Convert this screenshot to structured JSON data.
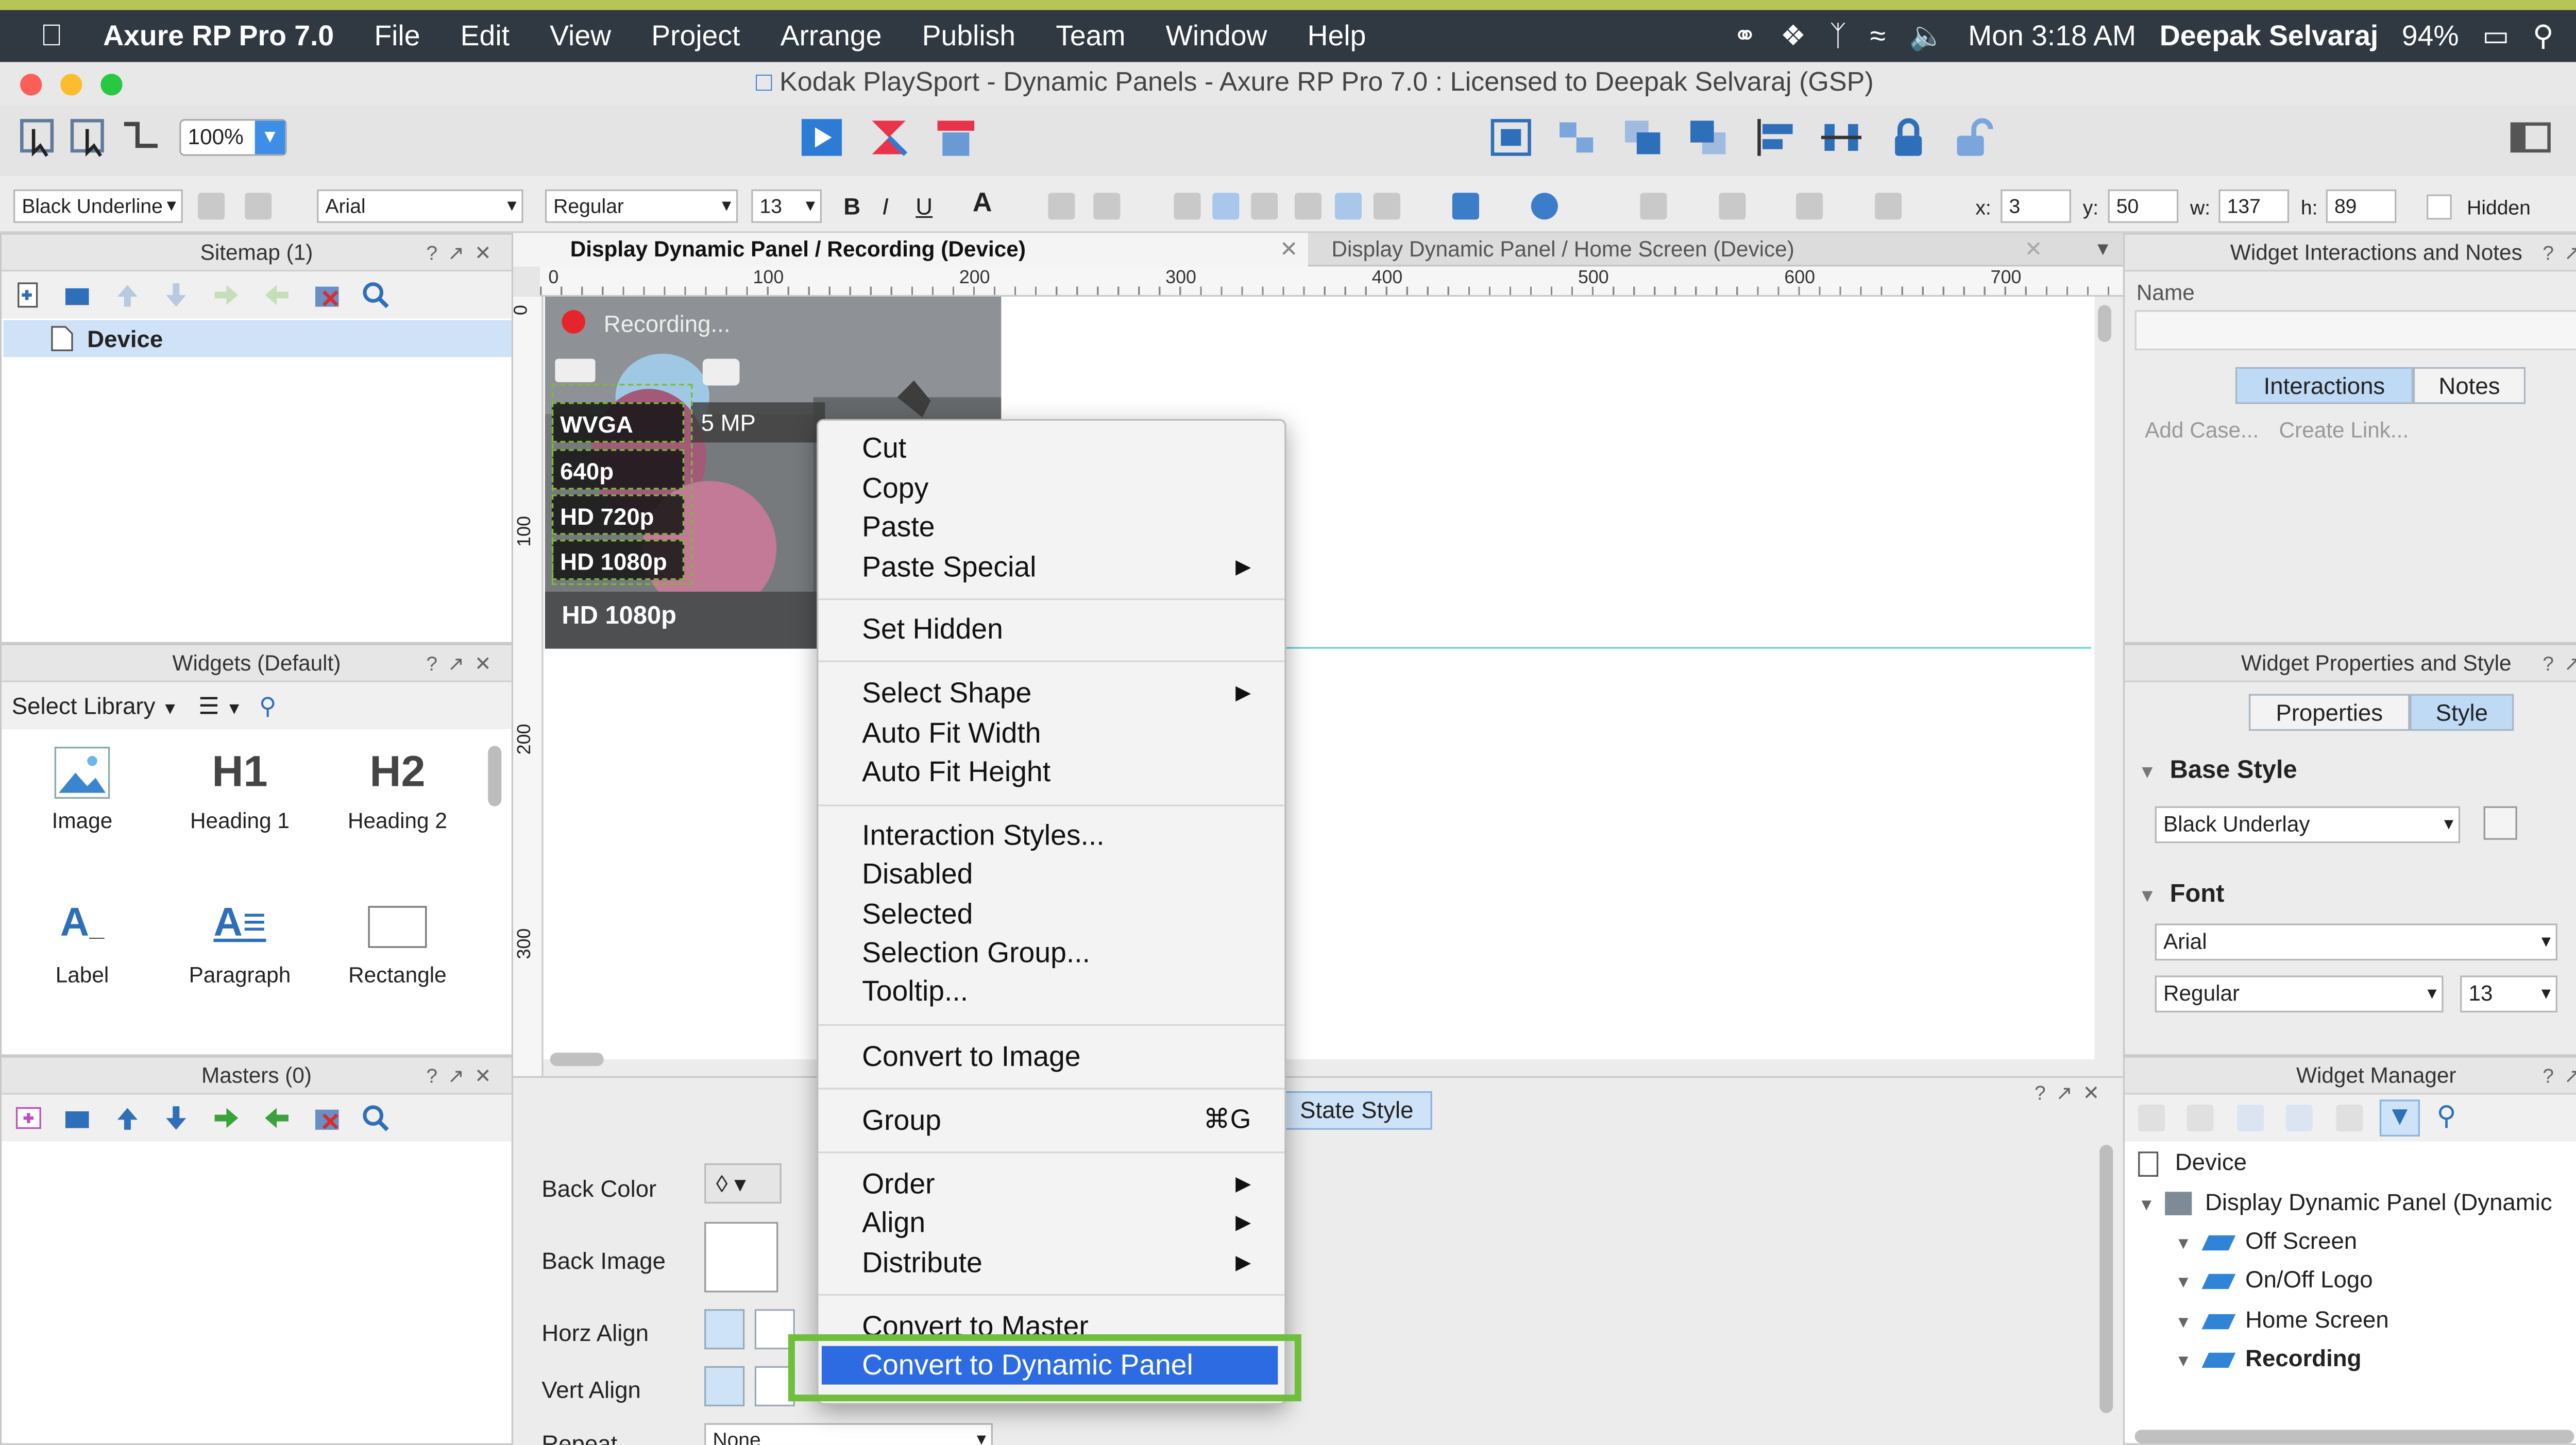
{
  "menubar": {
    "app_name": "Axure RP Pro 7.0",
    "menus": [
      "File",
      "Edit",
      "View",
      "Project",
      "Arrange",
      "Publish",
      "Team",
      "Window",
      "Help"
    ],
    "clock": "Mon 3:18 AM",
    "user": "Deepak Selvaraj",
    "battery": "94%"
  },
  "window": {
    "title": "Kodak PlaySport - Dynamic Panels - Axure RP Pro 7.0 : Licensed to Deepak Selvaraj (GSP)"
  },
  "toolbar": {
    "zoom": "100%"
  },
  "format_bar": {
    "style": "Black Underline",
    "font": "Arial",
    "weight": "Regular",
    "size": "13",
    "x_label": "x:",
    "x": "3",
    "y_label": "y:",
    "y": "50",
    "w_label": "w:",
    "w": "137",
    "h_label": "h:",
    "h": "89",
    "hidden_label": "Hidden"
  },
  "sitemap": {
    "title": "Sitemap (1)",
    "page": "Device"
  },
  "widgets": {
    "title": "Widgets (Default)",
    "select_library": "Select Library",
    "items": [
      {
        "icon": "image-icon",
        "glyph": "",
        "label": "Image"
      },
      {
        "icon": "heading1-icon",
        "glyph": "H1",
        "label": "Heading 1"
      },
      {
        "icon": "heading2-icon",
        "glyph": "H2",
        "label": "Heading 2"
      },
      {
        "icon": "label-icon",
        "glyph": "A_",
        "label": "Label"
      },
      {
        "icon": "paragraph-icon",
        "glyph": "A≡",
        "label": "Paragraph"
      },
      {
        "icon": "rectangle-icon",
        "glyph": "",
        "label": "Rectangle"
      }
    ]
  },
  "masters": {
    "title": "Masters (0)"
  },
  "tabs": [
    {
      "label": "Display Dynamic Panel / Recording (Device)",
      "active": true
    },
    {
      "label": "Display Dynamic Panel / Home Screen (Device)",
      "active": false
    }
  ],
  "ruler": {
    "h_ticks": [
      "0",
      "100",
      "200",
      "300",
      "400",
      "500",
      "600",
      "700"
    ],
    "v_ticks": [
      "0",
      "100",
      "200",
      "300"
    ]
  },
  "design": {
    "recording": "Recording...",
    "resolutions": [
      "WVGA",
      "640p",
      "HD 720p",
      "HD 1080p"
    ],
    "mp": "5 MP",
    "bottom": "HD 1080p"
  },
  "context_menu": {
    "items": [
      "Cut",
      "Copy",
      "Paste",
      "Paste Special",
      "Set Hidden",
      "Select Shape",
      "Auto Fit Width",
      "Auto Fit Height",
      "Interaction Styles...",
      "Disabled",
      "Selected",
      "Selection Group...",
      "Tooltip...",
      "Convert to Image",
      "Group",
      "Order",
      "Align",
      "Distribute",
      "Convert to Master",
      "Convert to Dynamic Panel"
    ],
    "group_shortcut": "⌘G"
  },
  "bottom_panel": {
    "state_style": "State Style",
    "back_color": "Back Color",
    "back_image": "Back Image",
    "horz_align": "Horz Align",
    "vert_align": "Vert Align",
    "repeat": "Repeat",
    "repeat_value": "None"
  },
  "interactions_panel": {
    "title": "Widget Interactions and Notes",
    "name_label": "Name",
    "tab_interactions": "Interactions",
    "tab_notes": "Notes",
    "add_case": "Add Case...",
    "create_link": "Create Link..."
  },
  "properties_panel": {
    "title": "Widget Properties and Style",
    "tab_properties": "Properties",
    "tab_style": "Style",
    "base_style_heading": "Base Style",
    "base_style_value": "Black Underlay",
    "font_heading": "Font",
    "font_value": "Arial",
    "weight_value": "Regular",
    "size_value": "13"
  },
  "widget_manager": {
    "title": "Widget Manager",
    "root": "Device",
    "panel": "Display Dynamic Panel (Dynamic",
    "states": [
      "Off Screen",
      "On/Off Logo",
      "Home Screen",
      "Recording"
    ]
  },
  "colors": {
    "accent": "#2d6be3",
    "highlight_border": "#6fbf3b",
    "menubar": "#303942"
  }
}
